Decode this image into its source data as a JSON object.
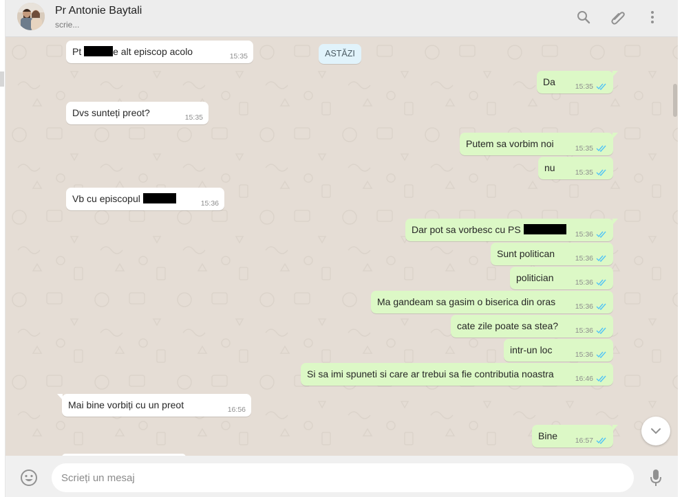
{
  "header": {
    "contact_name": "Pr Antonie Baytali",
    "status": "scrie...",
    "icons": [
      "search-icon",
      "attach-icon",
      "menu-icon"
    ]
  },
  "conversation": {
    "date_divider": "ASTĂZI",
    "messages": [
      {
        "direction": "in",
        "parts": [
          "Pt ",
          "e alt episcop acolo"
        ],
        "redacted": true,
        "time": "15:35"
      },
      {
        "direction": "out",
        "text": "Da",
        "time": "15:35",
        "status": "read"
      },
      {
        "direction": "in",
        "text": "Dvs sunteți preot?",
        "time": "15:35"
      },
      {
        "direction": "out",
        "text": "Putem sa vorbim noi",
        "time": "15:35",
        "status": "read"
      },
      {
        "direction": "out",
        "text": "nu",
        "time": "15:35",
        "status": "read"
      },
      {
        "direction": "in",
        "parts": [
          "Vb cu episcopul "
        ],
        "redacted": true,
        "time": "15:36"
      },
      {
        "direction": "out",
        "parts": [
          "Dar pot sa vorbesc cu PS "
        ],
        "redacted": true,
        "time": "15:36",
        "status": "read"
      },
      {
        "direction": "out",
        "text": "Sunt politican",
        "time": "15:36",
        "status": "read"
      },
      {
        "direction": "out",
        "text": "politician",
        "time": "15:36",
        "status": "read"
      },
      {
        "direction": "out",
        "text": "Ma gandeam sa gasim o biserica din oras",
        "time": "15:36",
        "status": "read"
      },
      {
        "direction": "out",
        "text": "cate zile poate sa stea?",
        "time": "15:36",
        "status": "read"
      },
      {
        "direction": "out",
        "text": "intr-un loc",
        "time": "15:36",
        "status": "read"
      },
      {
        "direction": "out",
        "text": "Si sa imi spuneti si care ar trebui sa fie contributia noastra",
        "time": "16:46",
        "status": "read"
      },
      {
        "direction": "in",
        "text": "Mai bine vorbiți cu un preot",
        "time": "16:56"
      },
      {
        "direction": "out",
        "text": "Bine",
        "time": "16:57",
        "status": "read"
      }
    ]
  },
  "composer": {
    "placeholder": "Scrieți un mesaj",
    "emoji_icon": "emoji-icon",
    "mic_icon": "microphone-icon"
  },
  "colors": {
    "header_bg": "#ededed",
    "chat_bg": "#e5ddd5",
    "incoming_bubble": "#ffffff",
    "outgoing_bubble": "#dcf8c6",
    "read_ticks": "#4fc3f7",
    "date_chip": "#e1f3fb"
  }
}
